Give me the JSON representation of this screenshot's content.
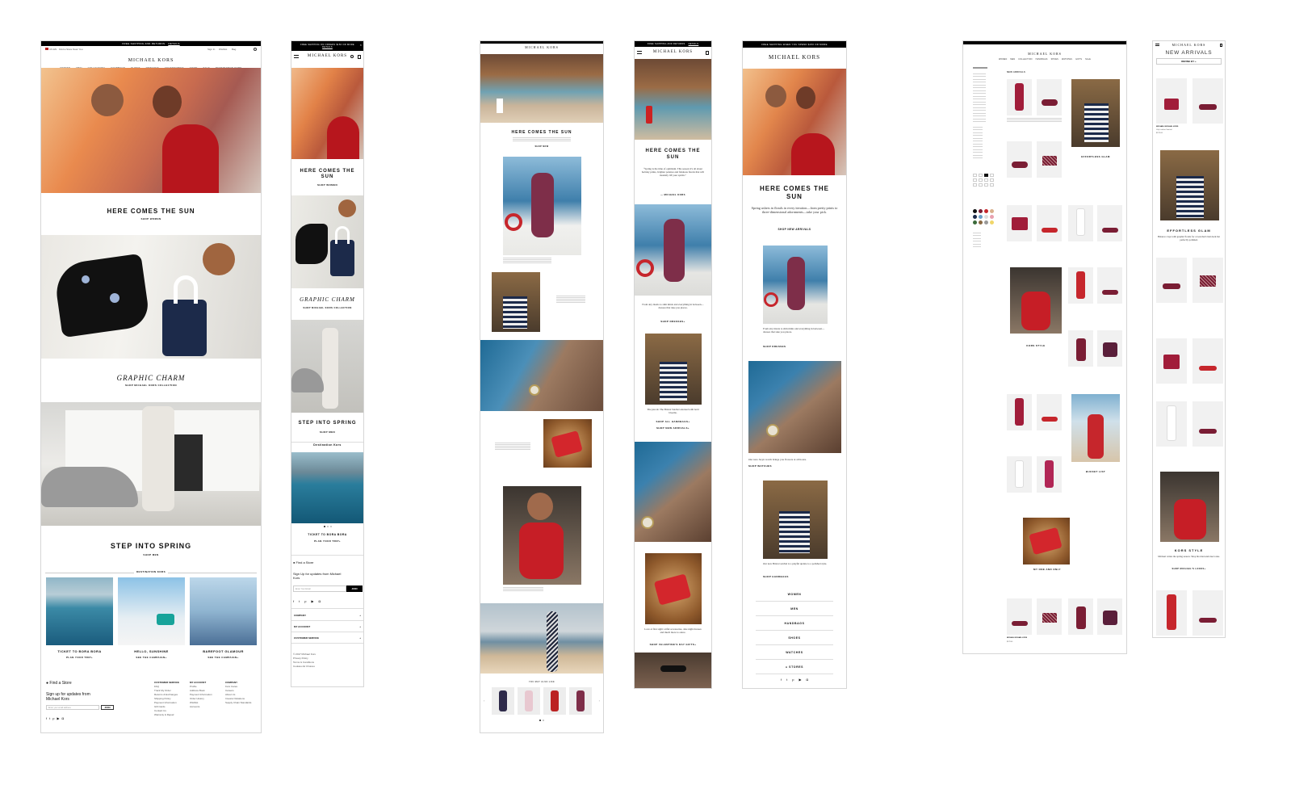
{
  "brand": "MICHAEL KORS",
  "desktop_home": {
    "topbar_text": "FREE SHIPPING AND RETURNS",
    "topbar_link": "DETAILS",
    "locale": "US EN",
    "find_store": "Find a Store Near You",
    "util": [
      "Sign In",
      "Wishlist",
      "Bag"
    ],
    "nav": [
      "WOMEN",
      "MEN",
      "COLLECTION",
      "HANDBAGS",
      "SHOES",
      "WATCHES",
      "ACCESSORIES",
      "GIFTS",
      "SALE",
      "DESTINATION KORS"
    ],
    "hero1_title": "HERE COMES THE SUN",
    "hero1_cta": "SHOP WOMEN",
    "hero2_title": "GRAPHIC CHARM",
    "hero2_cta": "SHOP MICHAEL KORS COLLECTION",
    "hero3_title": "STEP INTO SPRING",
    "hero3_cta": "SHOP MEN",
    "destination_label": "DESTINATION KORS",
    "tiles": [
      {
        "title": "TICKET TO BORA BORA",
        "cta": "PLAN YOUR TRIP+"
      },
      {
        "title": "HELLO, SUNSHINE",
        "cta": "SEE THE CAMPAIGN+"
      },
      {
        "title": "BAREFOOT GLAMOUR",
        "cta": "SEE THE CAMPAIGN+"
      }
    ],
    "footer_find": "Find a Store",
    "footer_signup": "Sign up for updates from Michael Kors",
    "footer_email_placeholder": "Enter your email address",
    "footer_join": "JOIN",
    "footer_cols": [
      {
        "title": "CUSTOMER SERVICE",
        "items": [
          "FAQ",
          "Track My Order",
          "Returns & Exchanges",
          "Shipping Policy",
          "Payment Information",
          "Gift Cards",
          "Contact Us",
          "Warranty & Repair"
        ]
      },
      {
        "title": "MY ACCOUNT",
        "items": [
          "Profile",
          "Address Book",
          "Payment Information",
          "Order History",
          "Wishlist",
          "Accounts"
        ]
      },
      {
        "title": "COMPANY",
        "items": [
          "Kors Cares",
          "Careers",
          "About Us",
          "Investor Relations",
          "Supply Chain Standards"
        ]
      }
    ]
  },
  "mobile_home": {
    "topbar_text": "FREE SHIPPING ON ORDERS $150 OR MORE",
    "topbar_link": "DETAILS",
    "hero1_title": "HERE COMES THE SUN",
    "hero1_cta": "SHOP WOMEN",
    "hero2_title": "GRAPHIC CHARM",
    "hero2_cta": "SHOP MICHAEL KORS COLLECTION",
    "hero3_title": "STEP INTO SPRING",
    "hero3_cta": "SHOP MEN",
    "destination_label": "Destination Kors",
    "tile_title": "TICKET TO BORA BORA",
    "tile_cta": "PLAN YOUR TRIP+",
    "find_store": "Find a Store",
    "signup": "Sign Up for updates from Michael Kors",
    "email_placeholder": "Enter Your Email",
    "join": "JOIN",
    "accordions": [
      "COMPANY",
      "MY ACCOUNT",
      "CUSTOMER SERVICE"
    ],
    "legal": [
      "© 2017 Michael Kors",
      "Privacy Policy",
      "Terms & Conditions",
      "Cookies Ad Choices"
    ]
  },
  "desktop_editorial": {
    "title": "HERE COMES THE SUN",
    "cta": "SHOP NOW",
    "carousel_label": "YOU MAY ALSO LIKE"
  },
  "tablet_editorial": {
    "topbar_text": "FREE SHIPPING AND RETURNS",
    "topbar_link": "DETAILS",
    "title": "HERE COMES THE SUN",
    "quote": "“Spring is the time of optimism. This season it's all about holiday prints, brighter palettes and fabulous florals that will instantly lift your spirits.”",
    "quote_by": "— MICHAEL KORS",
    "dress_text": "From airy maxis to slim minis and everything in between—dresses that take you places.",
    "dress_cta": "SHOP DRESSES+",
    "bag_text": "The just-in: The Bristol Satchel adorned with bold blooms.",
    "bag_cta1": "SHOP ALL HANDBAGS+",
    "bag_cta2": "SHOP NEW ARRIVALS+",
    "love_text": "Love at first sight: artful accessories, date night dresses and much more to adore.",
    "love_cta": "SHOP VALENTINE'S DAY GIFTS+"
  },
  "mobile_editorial": {
    "topbar_text": "FREE SHIPPING WHEN YOU SPEND $150 OR MORE",
    "title": "HERE COMES THE SUN",
    "intro": "Spring ushers in florals in every iteration—from pretty prints to three-dimensional adornments—take your pick.",
    "intro_cta": "SHOP NEW ARRIVALS",
    "dress_text": "From airy maxis to slim minis and everything in between—dresses that take you places.",
    "dress_cta": "SHOP DRESSES",
    "watch_text": "Our new Jaryn watch brings you flowers at all hours.",
    "watch_cta": "SHOP WATCHES",
    "bag_text": "Our new Bristol satchel is a playful update to a polished style.",
    "bag_cta": "SHOP HANDBAGS",
    "menu": [
      "WOMEN",
      "MEN",
      "HANDBAGS",
      "SHOES",
      "WATCHES",
      "STORES"
    ]
  },
  "desktop_category": {
    "title": "NEW ARRIVALS",
    "promo1_title": "EFFORTLESS GLAM",
    "promo2_title": "KORS STYLE",
    "promo3_title": "BUCKET LIST",
    "promo4_title": "MY ONE AND ONLY",
    "product_name": "MICHAEL MICHAEL KORS",
    "price": "$178.00"
  },
  "mobile_category": {
    "title": "NEW ARRIVALS",
    "refine": "REFINE BY +",
    "product_name": "MICHAEL MICHAEL KORS",
    "product_desc": "Lilly Leather Satchel",
    "price": "$178.00",
    "promo1_title": "EFFORTLESS GLAM",
    "promo1_text": "Balance crops with graphic florals for a look that's laid-back but perfectly polished.",
    "promo2_title": "KORS STYLE",
    "promo2_text": "Michael writes the spring season. Shop his tried-and-true looks.",
    "promo2_cta": "SHOP MICHAEL'S LOOKS+"
  },
  "colors": {
    "accent_red": "#c0202a",
    "black": "#000000",
    "burgundy": "#7a1d34",
    "navy": "#1c2a4a"
  }
}
